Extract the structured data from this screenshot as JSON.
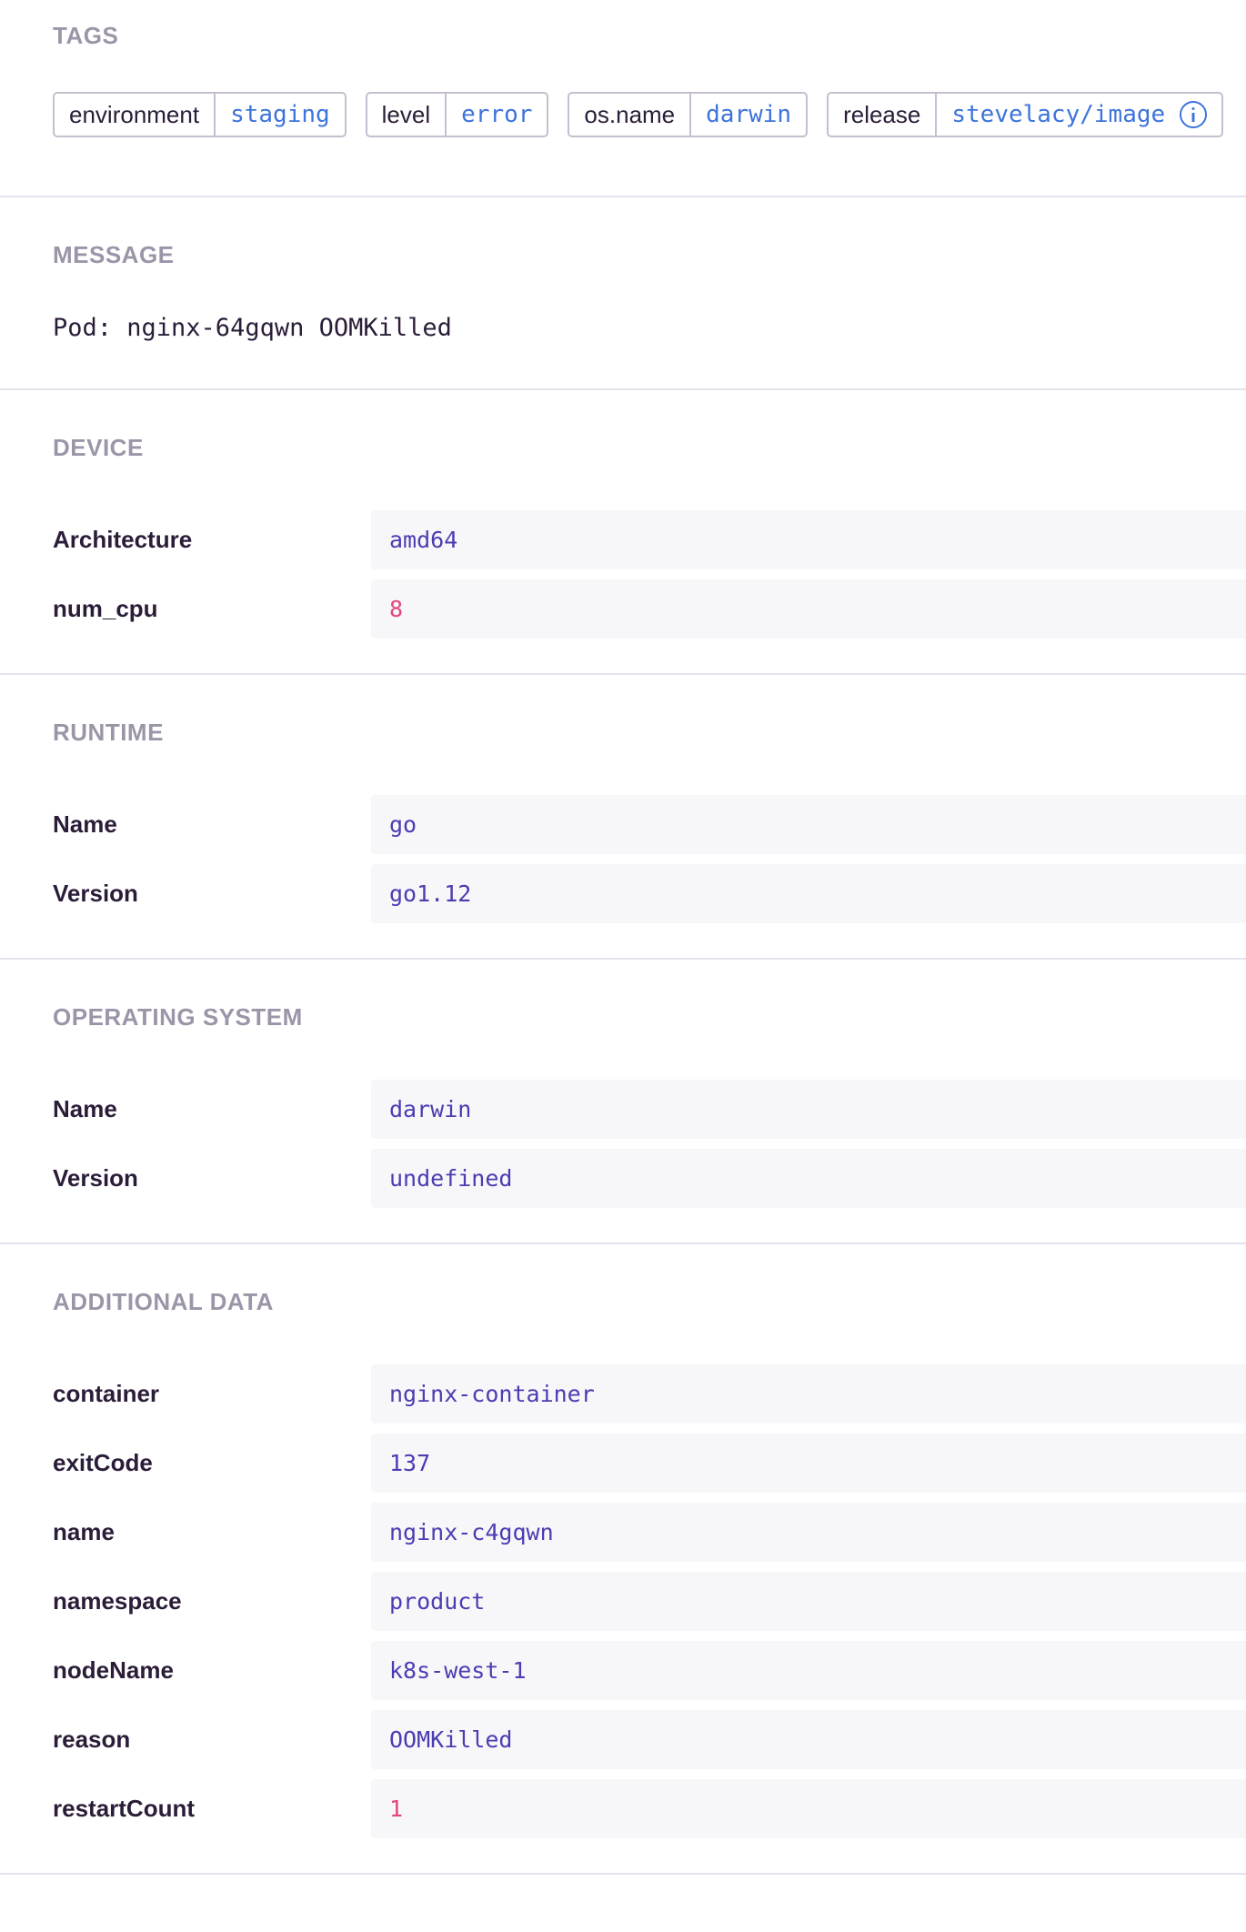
{
  "tags": {
    "title": "TAGS",
    "items": [
      {
        "key": "environment",
        "value": "staging"
      },
      {
        "key": "level",
        "value": "error"
      },
      {
        "key": "os.name",
        "value": "darwin"
      },
      {
        "key": "release",
        "value": "stevelacy/image"
      }
    ]
  },
  "message": {
    "title": "MESSAGE",
    "text": "Pod: nginx-64gqwn OOMKilled"
  },
  "device": {
    "title": "DEVICE",
    "rows": [
      {
        "key": "Architecture",
        "value": "amd64"
      },
      {
        "key": "num_cpu",
        "value": "8"
      }
    ]
  },
  "runtime": {
    "title": "RUNTIME",
    "rows": [
      {
        "key": "Name",
        "value": "go"
      },
      {
        "key": "Version",
        "value": "go1.12"
      }
    ]
  },
  "os": {
    "title": "OPERATING SYSTEM",
    "rows": [
      {
        "key": "Name",
        "value": "darwin"
      },
      {
        "key": "Version",
        "value": "undefined"
      }
    ]
  },
  "additional": {
    "title": "ADDITIONAL DATA",
    "rows": [
      {
        "key": "container",
        "value": "nginx-container"
      },
      {
        "key": "exitCode",
        "value": "137"
      },
      {
        "key": "name",
        "value": "nginx-c4gqwn"
      },
      {
        "key": "namespace",
        "value": "product"
      },
      {
        "key": "nodeName",
        "value": "k8s-west-1"
      },
      {
        "key": "reason",
        "value": "OOMKilled"
      },
      {
        "key": "restartCount",
        "value": "1"
      }
    ]
  },
  "colors": {
    "string_value": "#4a3db1",
    "number_value": "#e1467c",
    "tag_value": "#3d74db",
    "section_title": "#9c95a8"
  },
  "icons": {
    "release_info": "info-icon"
  }
}
